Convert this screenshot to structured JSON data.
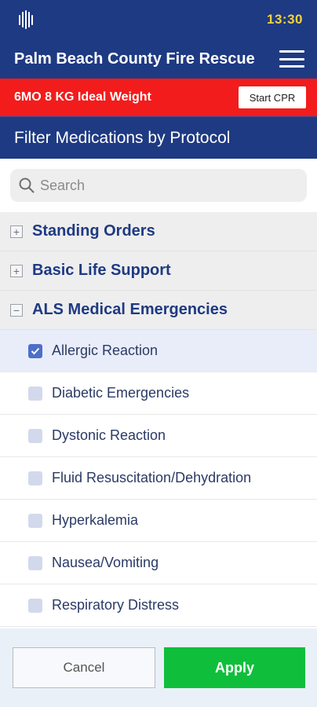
{
  "status_bar": {
    "time": "13:30"
  },
  "header": {
    "title": "Palm Beach County Fire Rescue"
  },
  "alert": {
    "text": "6MO 8 KG Ideal Weight",
    "button_label": "Start CPR"
  },
  "filter": {
    "title": "Filter Medications by Protocol"
  },
  "search": {
    "placeholder": "Search"
  },
  "groups": [
    {
      "label": "Standing Orders",
      "expanded": false
    },
    {
      "label": "Basic Life Support",
      "expanded": false
    },
    {
      "label": "ALS Medical Emergencies",
      "expanded": true
    }
  ],
  "items": [
    {
      "label": "Allergic Reaction",
      "checked": true
    },
    {
      "label": "Diabetic Emergencies",
      "checked": false
    },
    {
      "label": "Dystonic Reaction",
      "checked": false
    },
    {
      "label": "Fluid Resuscitation/Dehydration",
      "checked": false
    },
    {
      "label": "Hyperkalemia",
      "checked": false
    },
    {
      "label": "Nausea/Vomiting",
      "checked": false
    },
    {
      "label": "Respiratory Distress",
      "checked": false
    }
  ],
  "footer": {
    "cancel_label": "Cancel",
    "apply_label": "Apply"
  },
  "colors": {
    "navy": "#1e3a82",
    "alert_red": "#f21c1c",
    "apply_green": "#0fbf3b",
    "time_yellow": "#f3d23a"
  }
}
